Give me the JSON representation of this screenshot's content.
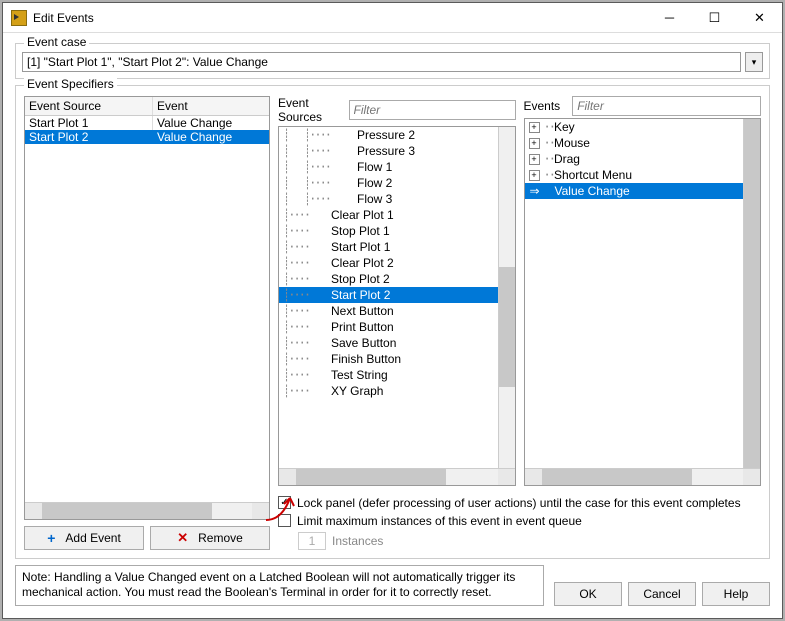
{
  "window": {
    "title": "Edit Events"
  },
  "event_case": {
    "label": "Event case",
    "text": "[1] \"Start Plot 1\", \"Start Plot 2\": Value Change"
  },
  "specifiers": {
    "label": "Event Specifiers",
    "columns": {
      "source": "Event Source",
      "event": "Event"
    },
    "rows": [
      {
        "source": "Start Plot 1",
        "event": "Value Change",
        "selected": false
      },
      {
        "source": "Start Plot 2",
        "event": "Value Change",
        "selected": true
      }
    ],
    "add_label": "Add Event",
    "remove_label": "Remove"
  },
  "sources": {
    "label": "Event Sources",
    "filter_placeholder": "Filter",
    "items": [
      {
        "label": "Pressure 2",
        "depth": 2
      },
      {
        "label": "Pressure 3",
        "depth": 2
      },
      {
        "label": "Flow 1",
        "depth": 2
      },
      {
        "label": "Flow 2",
        "depth": 2
      },
      {
        "label": "Flow 3",
        "depth": 2
      },
      {
        "label": "Clear Plot 1",
        "depth": 1
      },
      {
        "label": "Stop Plot 1",
        "depth": 1
      },
      {
        "label": "Start Plot 1",
        "depth": 1
      },
      {
        "label": "Clear Plot 2",
        "depth": 1
      },
      {
        "label": "Stop Plot 2",
        "depth": 1
      },
      {
        "label": "Start Plot 2",
        "depth": 1,
        "selected": true
      },
      {
        "label": "Next Button",
        "depth": 1
      },
      {
        "label": "Print Button",
        "depth": 1
      },
      {
        "label": "Save Button",
        "depth": 1
      },
      {
        "label": "Finish Button",
        "depth": 1
      },
      {
        "label": "Test String",
        "depth": 1
      },
      {
        "label": "XY Graph",
        "depth": 1
      }
    ]
  },
  "events": {
    "label": "Events",
    "filter_placeholder": "Filter",
    "items": [
      {
        "label": "Key",
        "expandable": true
      },
      {
        "label": "Mouse",
        "expandable": true
      },
      {
        "label": "Drag",
        "expandable": true
      },
      {
        "label": "Shortcut Menu",
        "expandable": true
      },
      {
        "label": "Value Change",
        "expandable": false,
        "selected": true,
        "arrow": true
      }
    ]
  },
  "options": {
    "lock_panel": {
      "checked": true,
      "label": "Lock panel (defer processing of user actions) until the case for this event completes"
    },
    "limit_instances": {
      "checked": false,
      "label": "Limit maximum instances of this event in event queue"
    },
    "instances_value": "1",
    "instances_label": "Instances"
  },
  "note": "Note:  Handling a Value Changed event on a Latched Boolean will not automatically trigger its mechanical action. You must read the Boolean's Terminal in order for it to correctly reset.",
  "buttons": {
    "ok": "OK",
    "cancel": "Cancel",
    "help": "Help"
  }
}
